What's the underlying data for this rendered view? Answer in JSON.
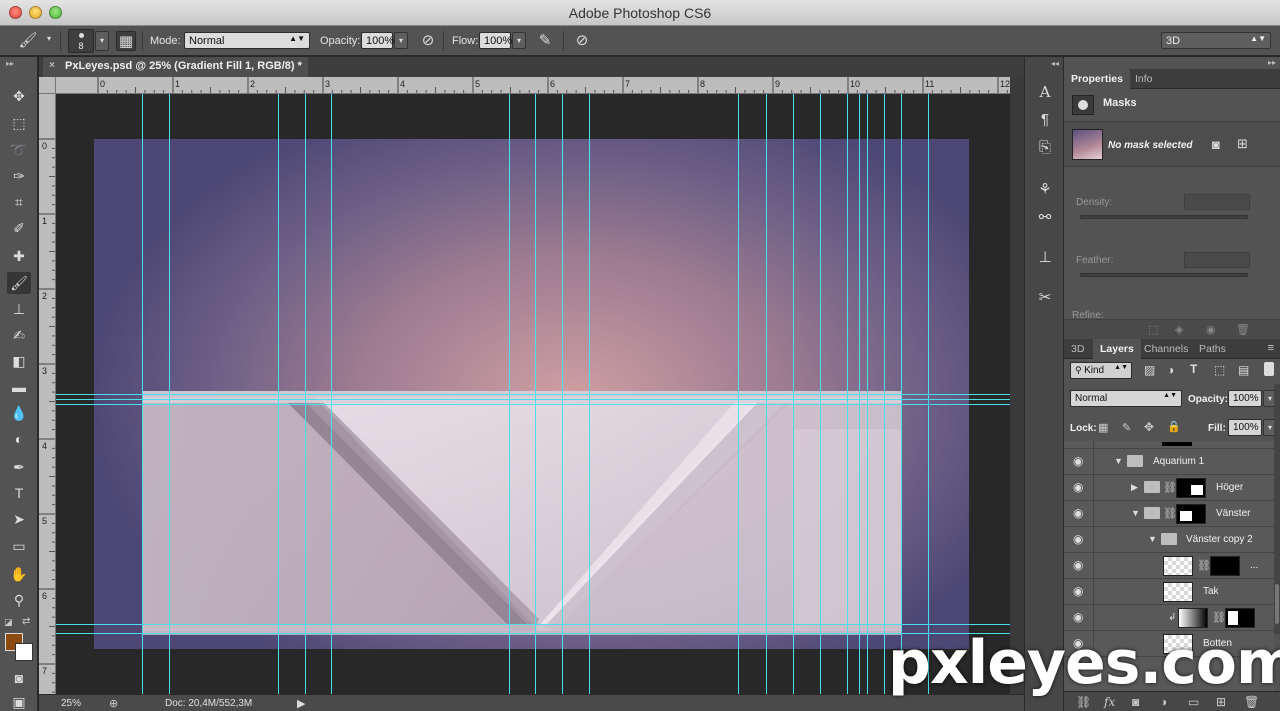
{
  "app": {
    "title": "Adobe Photoshop CS6"
  },
  "options": {
    "brush_size": "8",
    "mode_label": "Mode:",
    "mode_value": "Normal",
    "opacity_label": "Opacity:",
    "opacity_value": "100%",
    "flow_label": "Flow:",
    "flow_value": "100%",
    "workspace_value": "3D"
  },
  "document": {
    "tab_title": "PxLeyes.psd @ 25% (Gradient Fill 1, RGB/8) *",
    "close_glyph": "×"
  },
  "rulers": {
    "top": [
      "0",
      "1",
      "2",
      "3",
      "4",
      "5",
      "6",
      "7",
      "8",
      "9",
      "10",
      "11",
      "12"
    ],
    "left": [
      "0",
      "1",
      "2",
      "3",
      "4",
      "5",
      "6",
      "7"
    ]
  },
  "status": {
    "zoom": "25%",
    "doc_size": "Doc: 20,4M/552,3M"
  },
  "colors": {
    "foreground": "#8b4a12",
    "background": "#ffffff",
    "guide": "#48e0ea"
  },
  "properties_panel": {
    "tabs": [
      "Properties",
      "Info"
    ],
    "section": "Masks",
    "no_mask": "No mask selected",
    "density_label": "Density:",
    "feather_label": "Feather:",
    "refine_label": "Refine:"
  },
  "layers_panel": {
    "tabs": [
      "3D",
      "Layers",
      "Channels",
      "Paths"
    ],
    "filter_kind": "Kind",
    "blend_mode": "Normal",
    "opacity_label": "Opacity:",
    "opacity_value": "100%",
    "lock_label": "Lock:",
    "fill_label": "Fill:",
    "fill_value": "100%",
    "layers": [
      {
        "name": "Aquarium 1"
      },
      {
        "name": "Höger"
      },
      {
        "name": "Vänster"
      },
      {
        "name": "Vänster copy 2"
      },
      {
        "name": "..."
      },
      {
        "name": "Tak"
      },
      {
        "name": ""
      },
      {
        "name": "Botten"
      }
    ]
  },
  "watermark": {
    "text": "pxleyes.com"
  }
}
